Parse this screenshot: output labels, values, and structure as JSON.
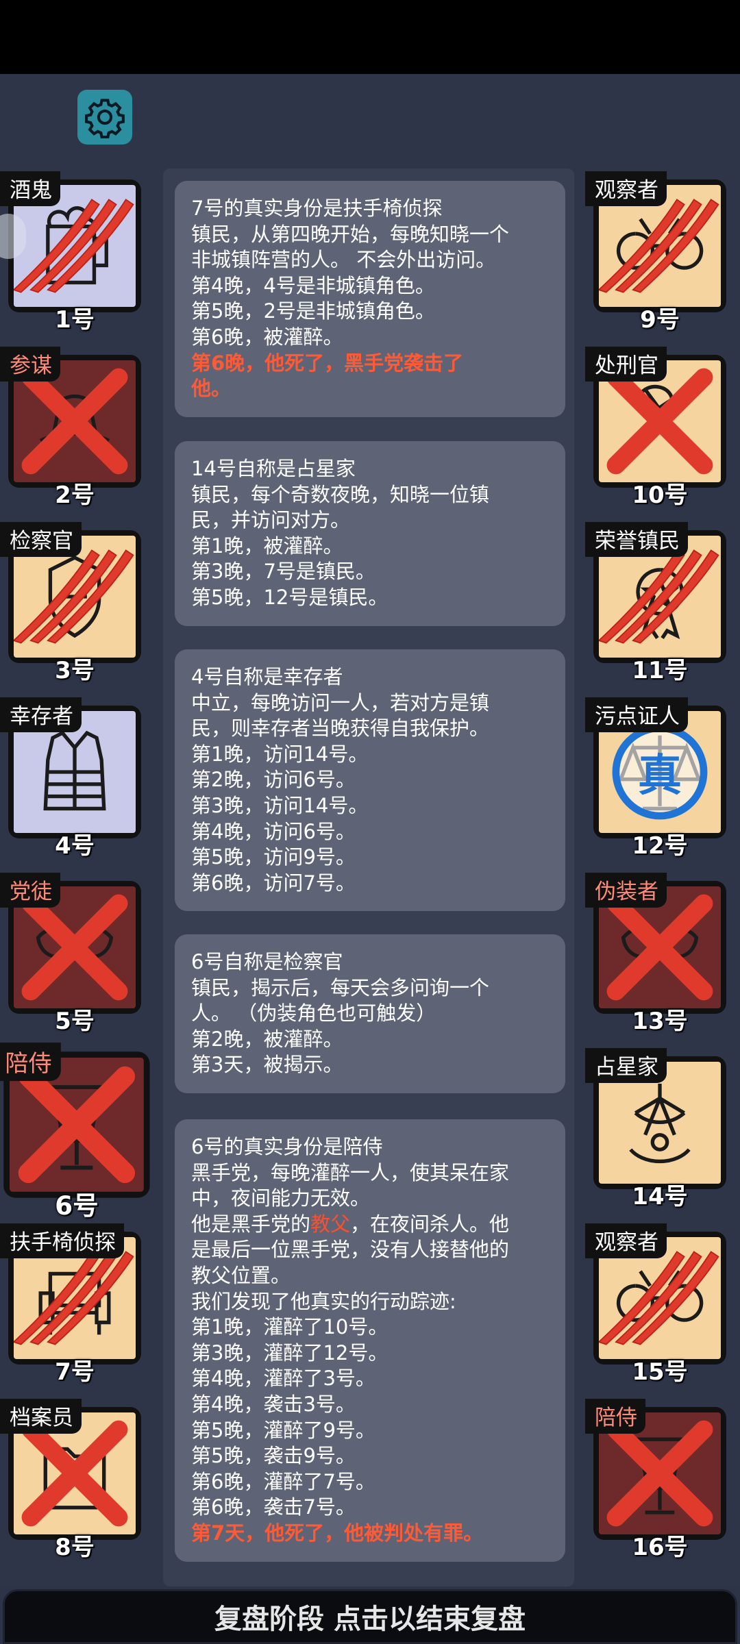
{
  "colors": {
    "accent": "#2b8fa0",
    "highlight": "#ff5a36",
    "panel": "#5e6475",
    "background": "#2f3549"
  },
  "settings_icon": "gear-icon",
  "bottom_bar": {
    "label": "复盘阶段 点击以结束复盘"
  },
  "left_cards": [
    {
      "role": "酒鬼",
      "num": "1号",
      "bg": "lav",
      "mark": "claw",
      "evil": false,
      "icon": "mug-icon"
    },
    {
      "role": "参谋",
      "num": "2号",
      "bg": "dark",
      "mark": "cross",
      "evil": true,
      "icon": "hat-icon"
    },
    {
      "role": "检察官",
      "num": "3号",
      "bg": "peach",
      "mark": "claw",
      "evil": false,
      "icon": "badge-icon"
    },
    {
      "role": "幸存者",
      "num": "4号",
      "bg": "lav",
      "mark": "none",
      "evil": false,
      "icon": "vest-icon"
    },
    {
      "role": "党徒",
      "num": "5号",
      "bg": "dark",
      "mark": "cross",
      "evil": true,
      "icon": "mask-icon"
    },
    {
      "role": "陪侍",
      "num": "6号",
      "bg": "dark",
      "mark": "cross",
      "evil": true,
      "icon": "glass-icon"
    },
    {
      "role": "扶手椅侦探",
      "num": "7号",
      "bg": "peach",
      "mark": "claw",
      "evil": false,
      "icon": "armchair-icon"
    },
    {
      "role": "档案员",
      "num": "8号",
      "bg": "peach",
      "mark": "cross",
      "evil": false,
      "icon": "folder-icon"
    }
  ],
  "right_cards": [
    {
      "role": "观察者",
      "num": "9号",
      "bg": "peach",
      "mark": "claw",
      "evil": false,
      "icon": "binoculars-icon"
    },
    {
      "role": "处刑官",
      "num": "10号",
      "bg": "peach",
      "mark": "cross",
      "evil": false,
      "icon": "axe-icon"
    },
    {
      "role": "荣誉镇民",
      "num": "11号",
      "bg": "peach",
      "mark": "claw",
      "evil": false,
      "icon": "medal-icon"
    },
    {
      "role": "污点证人",
      "num": "12号",
      "bg": "peach",
      "mark": "true",
      "evil": false,
      "icon": "scales-icon",
      "stamp": "真"
    },
    {
      "role": "伪装者",
      "num": "13号",
      "bg": "dark",
      "mark": "cross",
      "evil": true,
      "icon": "mask-icon"
    },
    {
      "role": "占星家",
      "num": "14号",
      "bg": "peach",
      "mark": "none",
      "evil": false,
      "icon": "sextant-icon"
    },
    {
      "role": "观察者",
      "num": "15号",
      "bg": "peach",
      "mark": "claw",
      "evil": false,
      "icon": "binoculars-icon"
    },
    {
      "role": "陪侍",
      "num": "16号",
      "bg": "dark",
      "mark": "cross",
      "evil": true,
      "icon": "glass-icon"
    }
  ],
  "log_entries": [
    {
      "lines": [
        {
          "t": "7号的真实身份是扶手椅侦探"
        },
        {
          "t": "镇民，从第四晚开始，每晚知晓一个"
        },
        {
          "t": "非城镇阵营的人。 不会外出访问。"
        },
        {
          "t": "第4晚，4号是非城镇角色。"
        },
        {
          "t": "第5晚，2号是非城镇角色。"
        },
        {
          "t": "第6晚，被灌醉。"
        },
        {
          "t": "第6晚，他死了，黑手党袭击了",
          "hl": true
        },
        {
          "t": "他。",
          "hl": true
        }
      ]
    },
    {
      "lines": [
        {
          "t": "14号自称是占星家"
        },
        {
          "t": "镇民，每个奇数夜晚，知晓一位镇"
        },
        {
          "t": "民，并访问对方。"
        },
        {
          "t": "第1晚，被灌醉。"
        },
        {
          "t": "第3晚，7号是镇民。"
        },
        {
          "t": "第5晚，12号是镇民。"
        }
      ]
    },
    {
      "lines": [
        {
          "t": "4号自称是幸存者"
        },
        {
          "t": "中立，每晚访问一人，若对方是镇"
        },
        {
          "t": "民，则幸存者当晚获得自我保护。"
        },
        {
          "t": "第1晚，访问14号。"
        },
        {
          "t": "第2晚，访问6号。"
        },
        {
          "t": "第3晚，访问14号。"
        },
        {
          "t": "第4晚，访问6号。"
        },
        {
          "t": "第5晚，访问9号。"
        },
        {
          "t": "第6晚，访问7号。"
        }
      ]
    },
    {
      "lines": [
        {
          "t": "6号自称是检察官"
        },
        {
          "t": "镇民，揭示后，每天会多问询一个"
        },
        {
          "t": "人。 （伪装角色也可触发）"
        },
        {
          "t": "第2晚，被灌醉。"
        },
        {
          "t": "第3天，被揭示。"
        }
      ]
    },
    {
      "lines": [
        {
          "t": "6号的真实身份是陪侍"
        },
        {
          "t": "黑手党，每晚灌醉一人，使其呆在家"
        },
        {
          "t": "中，夜间能力无效。"
        },
        {
          "pre": "他是黑手党的",
          "red": "教父",
          "post": "，在夜间杀人。他"
        },
        {
          "t": "是最后一位黑手党，没有人接替他的"
        },
        {
          "t": "教父位置。"
        },
        {
          "t": "我们发现了他真实的行动踪迹:"
        },
        {
          "t": "第1晚，灌醉了10号。"
        },
        {
          "t": "第3晚，灌醉了12号。"
        },
        {
          "t": "第4晚，灌醉了3号。"
        },
        {
          "t": "第4晚，袭击3号。"
        },
        {
          "t": "第5晚，灌醉了9号。"
        },
        {
          "t": "第5晚，袭击9号。"
        },
        {
          "t": "第6晚，灌醉了7号。"
        },
        {
          "t": "第6晚，袭击7号。"
        },
        {
          "t": "第7天，他死了，他被判处有罪。",
          "hl": true
        }
      ]
    }
  ]
}
